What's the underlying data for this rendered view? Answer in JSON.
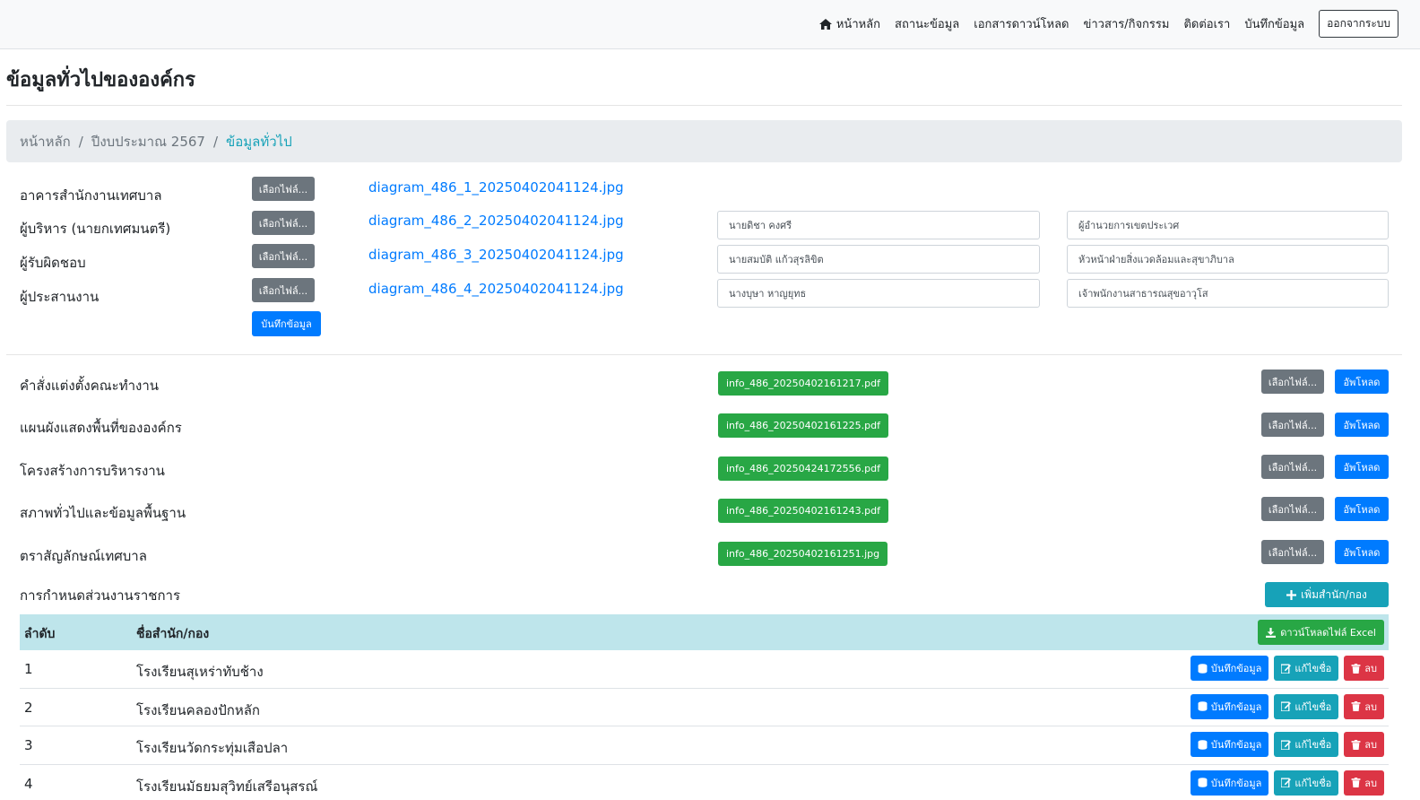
{
  "nav": {
    "home": "หน้าหลัก",
    "status": "สถานะข้อมูล",
    "downloads": "เอกสารดาวน์โหลด",
    "news": "ข่าวสาร/กิจกรรม",
    "contact": "ติดต่อเรา",
    "record": "บันทึกข้อมูล",
    "logout": "ออกจากระบบ"
  },
  "page_title": "ข้อมูลทั่วไปขององค์กร",
  "breadcrumb": {
    "home": "หน้าหลัก",
    "year": "ปีงบประมาณ 2567",
    "current": "ข้อมูลทั่วไป"
  },
  "people": {
    "choose_file_label": "เลือกไฟล์...",
    "save_label": "บันทึกข้อมูล",
    "rows": [
      {
        "label": "อาคารสำนักงานเทศบาล",
        "file": "diagram_486_1_20250402041124.jpg",
        "name": "",
        "position": ""
      },
      {
        "label": "ผู้บริหาร (นายกเทศมนตรี)",
        "file": "diagram_486_2_20250402041124.jpg",
        "name": "นายดิชา คงศรี",
        "position": "ผู้อำนวยการเขตประเวศ"
      },
      {
        "label": "ผู้รับผิดชอบ",
        "file": "diagram_486_3_20250402041124.jpg",
        "name": "นายสมบัติ แก้วสุรลิขิต",
        "position": "หัวหน้าฝ่ายสิ่งแวดล้อมและสุขาภิบาล"
      },
      {
        "label": "ผู้ประสานงาน",
        "file": "diagram_486_4_20250402041124.jpg",
        "name": "นางบุษา หาญยุทธ",
        "position": "เจ้าพนักงานสาธารณสุขอาวุโส"
      }
    ]
  },
  "documents": {
    "choose_file_label": "เลือกไฟล์...",
    "upload_label": "อัพโหลด",
    "rows": [
      {
        "label": "คำสั่งแต่งตั้งคณะทำงาน",
        "file": "info_486_20250402161217.pdf"
      },
      {
        "label": "แผนผังแสดงพื้นที่ขององค์กร",
        "file": "info_486_20250402161225.pdf"
      },
      {
        "label": "โครงสร้างการบริหารงาน",
        "file": "info_486_20250424172556.pdf"
      },
      {
        "label": "สภาพทั่วไปและข้อมูลพื้นฐาน",
        "file": "info_486_20250402161243.pdf"
      },
      {
        "label": "ตราสัญลักษณ์เทศบาล",
        "file": "info_486_20250402161251.jpg"
      }
    ]
  },
  "units": {
    "title": "การกำหนดส่วนงานราชการ",
    "add_button": "เพิ่มสำนัก/กอง",
    "download_excel": "ดาวน์โหลดไฟล์ Excel",
    "columns": [
      "ลำดับ",
      "ชื่อสำนัก/กอง"
    ],
    "actions": {
      "save": "บันทึกข้อมูล",
      "edit": "แก้ไขชื่อ",
      "delete": "ลบ"
    },
    "rows": [
      {
        "no": "1",
        "name": "โรงเรียนสุเหร่าทับช้าง"
      },
      {
        "no": "2",
        "name": "โรงเรียนคลองปักหลัก"
      },
      {
        "no": "3",
        "name": "โรงเรียนวัดกระทุ่มเสือปลา"
      },
      {
        "no": "4",
        "name": "โรงเรียนมัธยมสุวิทย์เสรีอนุสรณ์"
      }
    ]
  },
  "colors": {
    "primary": "#007bff",
    "secondary": "#6c757d",
    "success": "#28a745",
    "info": "#17a2b8",
    "danger": "#dc3545",
    "table_header": "#bee5eb"
  },
  "icons": [
    "home-icon",
    "plus-icon",
    "download-icon",
    "database-icon",
    "edit-icon",
    "trash-icon"
  ]
}
